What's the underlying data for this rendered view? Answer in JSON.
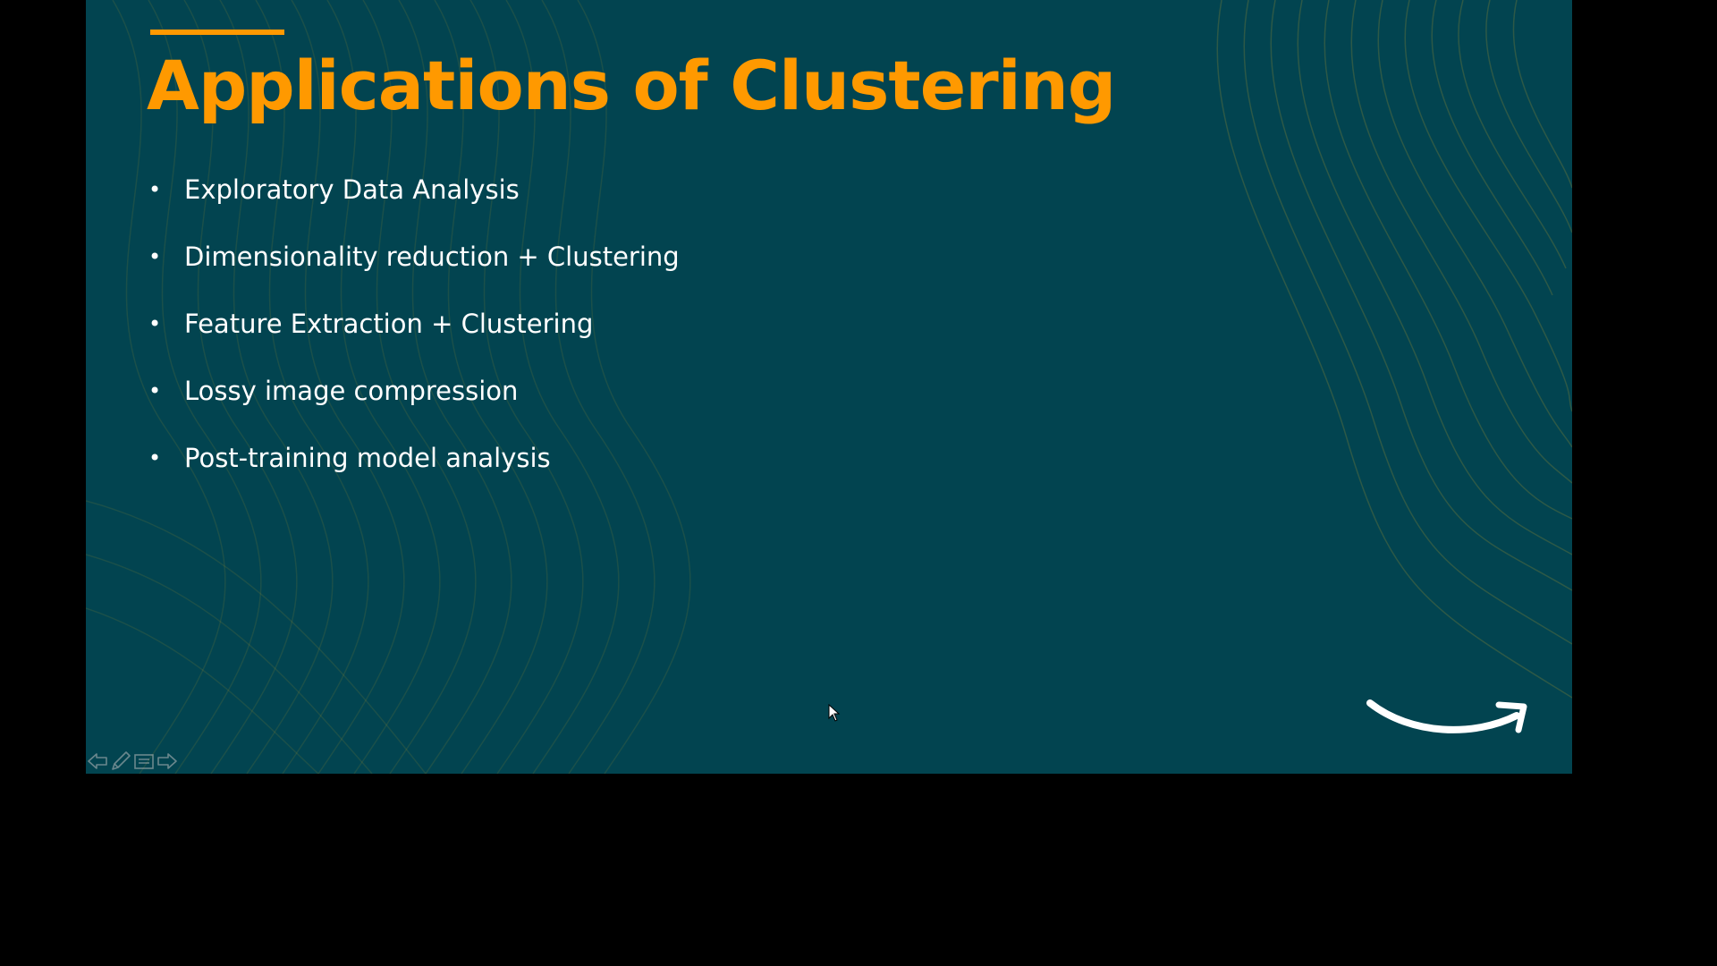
{
  "slide": {
    "title": "Applications of Clustering",
    "bullets": [
      "Exploratory Data Analysis",
      "Dimensionality reduction + Clustering",
      "Feature Extraction + Clustering",
      "Lossy image compression",
      "Post-training model analysis"
    ],
    "bullet_glyph": "•",
    "logo": "amazon-smile-icon"
  },
  "controls": {
    "icons": [
      "arrow-left-icon",
      "pen-icon",
      "menu-icon",
      "arrow-right-icon"
    ]
  },
  "colors": {
    "slide_background": "#024450",
    "title": "#ff9900",
    "accent_bar": "#ff9900",
    "body_text": "#ffffff",
    "outer_background": "#000000"
  }
}
